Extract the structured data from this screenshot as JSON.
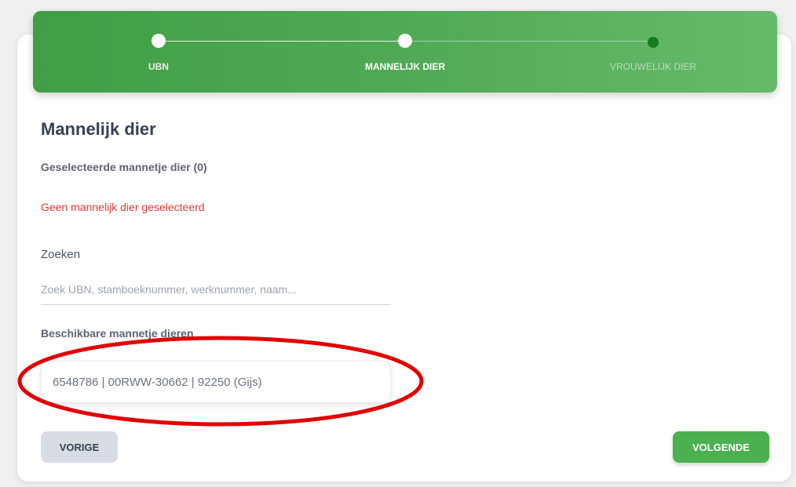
{
  "stepper": {
    "steps": [
      {
        "label": "UBN",
        "state": "completed"
      },
      {
        "label": "MANNELIJK DIER",
        "state": "active"
      },
      {
        "label": "VROUWELIJK DIER",
        "state": "pending"
      }
    ]
  },
  "form": {
    "title": "Mannelijk dier",
    "selected_label": "Geselecteerde mannetje dier (0)",
    "empty_message": "Geen mannelijk dier geselecteerd",
    "search_label": "Zoeken",
    "search_placeholder": "Zoek UBN, stamboeknummer, werknummer, naam...",
    "search_value": "",
    "available_label": "Beschikbare mannetje dieren",
    "available_animals": [
      {
        "text": "6548786 | 00RWW-30662 | 92250 (Gijs)"
      }
    ]
  },
  "buttons": {
    "previous": "VORIGE",
    "next": "VOLGENDE"
  },
  "colors": {
    "stepper_bg": "#4caf50",
    "error_text": "#e53935",
    "annotation": "#e10000"
  }
}
